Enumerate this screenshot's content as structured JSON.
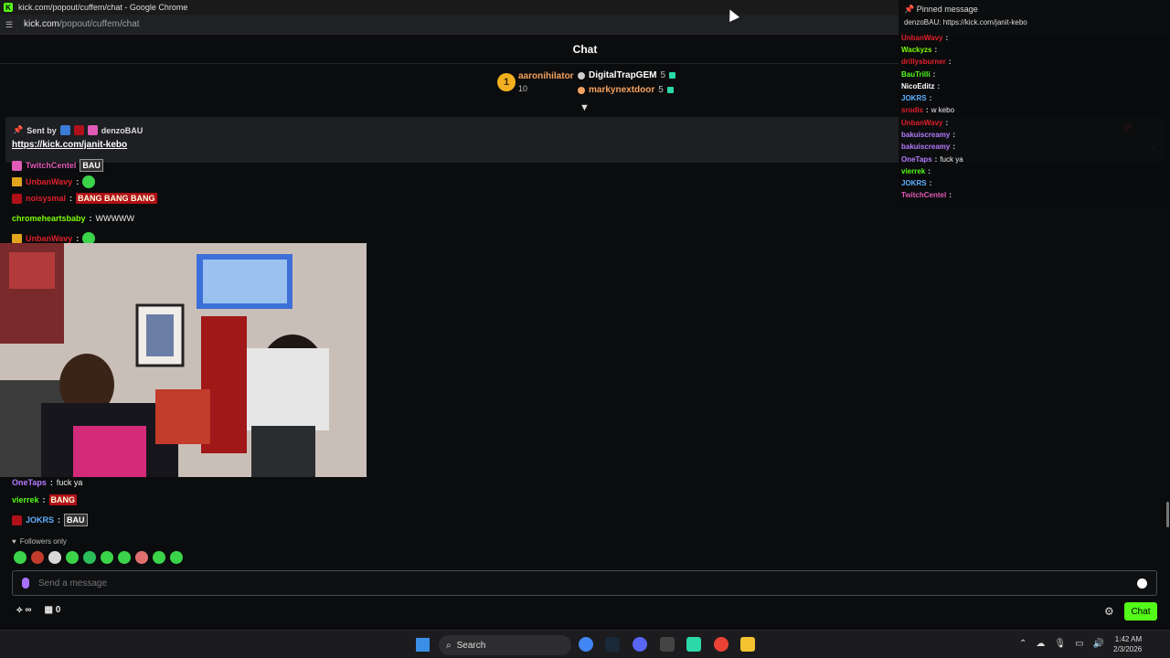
{
  "window": {
    "title": "kick.com/popout/cuffem/chat - Google Chrome"
  },
  "address": {
    "host": "kick.com",
    "path": "/popout/cuffem/chat"
  },
  "chat_header": {
    "title": "Chat"
  },
  "leaderboard": {
    "first": {
      "rank": "1",
      "name": "aaronihilator",
      "count": "10"
    },
    "rows": [
      {
        "name": "DigitalTrapGEM",
        "count": "5",
        "color": "#ffffff"
      },
      {
        "name": "markynextdoor",
        "count": "5",
        "color": "#f4a261"
      }
    ]
  },
  "pinned": {
    "sent_by_label": "Sent by",
    "sender": "denzoBAU",
    "link": "https://kick.com/janit-kebo"
  },
  "messages": [
    {
      "user": "TwitchCentel",
      "color": "#e05ab6",
      "text": ""
    },
    {
      "user": "UnbanWavy",
      "color": "#e0202a",
      "text": ""
    },
    {
      "user": "noisysmal",
      "color": "#e0202a",
      "text": ""
    },
    {
      "user": "chromeheartsbaby",
      "color": "#7cfc00",
      "text": "WWWWW"
    },
    {
      "user": "UnbanWavy",
      "color": "#e0202a",
      "text": ""
    },
    {
      "user": "OneTaps",
      "color": "#b57cff",
      "text": "fuck ya"
    },
    {
      "user": "vierrek",
      "color": "#53fc18",
      "text": ""
    },
    {
      "user": "JOKRS",
      "color": "#5fb0ff",
      "text": ""
    }
  ],
  "emote_text": {
    "bang": "BANG BANG BANG",
    "bau": "BAU",
    "bang_single": "BANG"
  },
  "followers_only": "Followers only",
  "input": {
    "placeholder": "Send a message"
  },
  "footer": {
    "count": "0",
    "chat_button": "Chat"
  },
  "popout": {
    "pinned_title": "Pinned message",
    "pinned_line": "denzoBAU: https://kick.com/janit-kebo",
    "messages": [
      {
        "user": "UnbanWavy",
        "color": "#e0202a",
        "text": ""
      },
      {
        "user": "Wackyzs",
        "color": "#7cfc00",
        "text": ""
      },
      {
        "user": "drillysburner",
        "color": "#e0202a",
        "text": ""
      },
      {
        "user": "BauTrilli",
        "color": "#53fc18",
        "text": ""
      },
      {
        "user": "NicoEditz",
        "color": "#ffffff",
        "text": ""
      },
      {
        "user": "JOKRS",
        "color": "#5fb0ff",
        "text": ""
      },
      {
        "user": "srodis",
        "color": "#e0202a",
        "text": "w kebo"
      },
      {
        "user": "UnbanWavy",
        "color": "#e0202a",
        "text": ""
      },
      {
        "user": "bakuiscreamy",
        "color": "#b57cff",
        "text": ""
      },
      {
        "user": "bakuiscreamy",
        "color": "#b57cff",
        "text": ""
      },
      {
        "user": "OneTaps",
        "color": "#b57cff",
        "text": "fuck ya"
      },
      {
        "user": "vierrek",
        "color": "#53fc18",
        "text": ""
      },
      {
        "user": "JOKRS",
        "color": "#5fb0ff",
        "text": ""
      },
      {
        "user": "TwitchCentel",
        "color": "#e05ab6",
        "text": ""
      }
    ]
  },
  "taskbar": {
    "search": "Search",
    "time": "1:42 AM",
    "date": "2/3/2026"
  },
  "colors": {
    "accent": "#53fc18",
    "background": "#0b0c0d"
  }
}
